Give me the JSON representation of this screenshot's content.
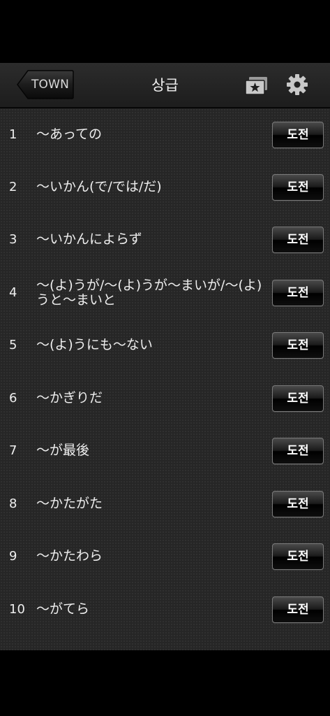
{
  "navbar": {
    "back_label": "TOWN",
    "title": "상급"
  },
  "colors": {
    "background": "#000000",
    "list_background": "#262626",
    "text": "#eeeeee"
  },
  "icons": {
    "bookmark": "bookmark-star-icon",
    "settings": "gear-icon"
  },
  "list": {
    "button_label": "도전",
    "items": [
      {
        "number": "1",
        "title": "〜あっての"
      },
      {
        "number": "2",
        "title": "〜いかん(で/では/だ)"
      },
      {
        "number": "3",
        "title": "〜いかんによらず"
      },
      {
        "number": "4",
        "title": "〜(よ)うが/〜(よ)うが〜まいが/〜(よ)うと〜まいと"
      },
      {
        "number": "5",
        "title": "〜(よ)うにも〜ない"
      },
      {
        "number": "6",
        "title": "〜かぎりだ"
      },
      {
        "number": "7",
        "title": "〜が最後"
      },
      {
        "number": "8",
        "title": "〜かたがた"
      },
      {
        "number": "9",
        "title": "〜かたわら"
      },
      {
        "number": "10",
        "title": "〜がてら"
      }
    ]
  }
}
